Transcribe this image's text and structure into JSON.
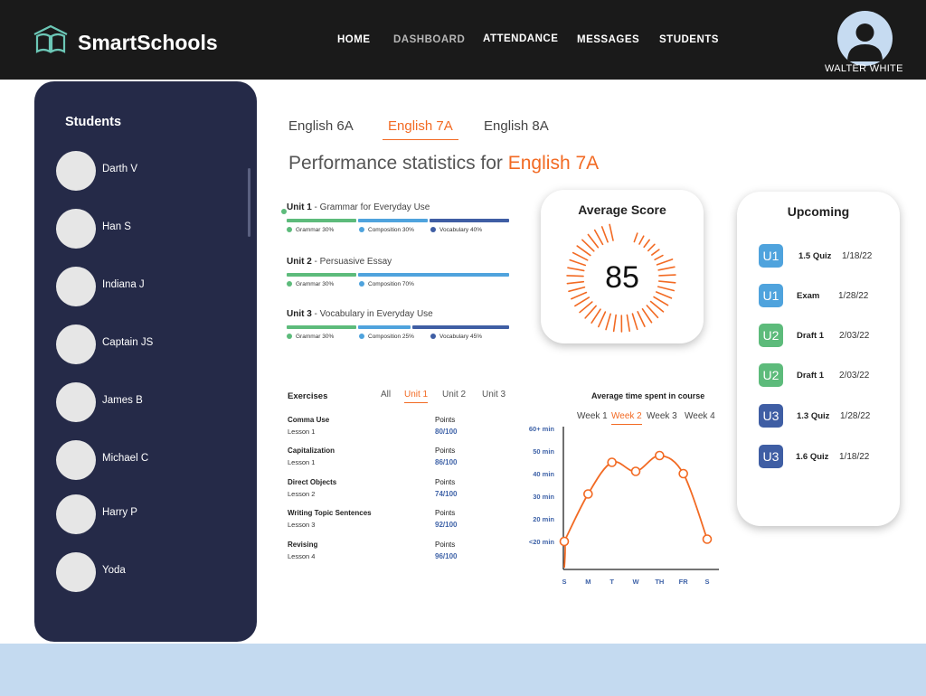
{
  "app": {
    "brand": "SmartSchools",
    "nav": [
      "HOME",
      "DASHBOARD",
      "ATTENDANCE",
      "MESSAGES",
      "STUDENTS"
    ],
    "user_name": "WALTER WHITE",
    "active_nav": "DASHBOARD"
  },
  "sidebar": {
    "title": "Students",
    "students": [
      "Darth V",
      "Han S",
      "Indiana J",
      "Captain JS",
      "James B",
      "Michael C",
      "Harry P",
      "Yoda"
    ]
  },
  "class_tabs": {
    "items": [
      "English 6A",
      "English 7A",
      "English 8A"
    ],
    "active": "English 7A"
  },
  "heading": {
    "prefix": "Performance statistics for",
    "class_name": "English 7A"
  },
  "units": [
    {
      "number": "Unit 1",
      "name": " - Grammar for Everyday Use",
      "segments": [
        {
          "label": "Grammar 30%",
          "color": "#5dbb7b"
        },
        {
          "label": "Composition 30%",
          "color": "#4fa3dd"
        },
        {
          "label": "Vocabulary 40%",
          "color": "#3f5ea4"
        }
      ]
    },
    {
      "number": "Unit 2",
      "name": " - Persuasive Essay",
      "segments": [
        {
          "label": "Grammar 30%",
          "color": "#5dbb7b"
        },
        {
          "label": "Composition 70%",
          "color": "#4fa3dd"
        }
      ]
    },
    {
      "number": "Unit 3",
      "name": " - Vocabulary in Everyday Use",
      "segments": [
        {
          "label": "Grammar 30%",
          "color": "#5dbb7b"
        },
        {
          "label": "Composition 25%",
          "color": "#4fa3dd"
        },
        {
          "label": "Vocabulary 45%",
          "color": "#3f5ea4"
        }
      ]
    }
  ],
  "average_score": {
    "title": "Average Score",
    "value": "85"
  },
  "upcoming": {
    "title": "Upcoming",
    "items": [
      {
        "unit": "U1",
        "type": "1.5 Quiz",
        "date": "1/18/22",
        "color": "#4fa3dd"
      },
      {
        "unit": "U1",
        "type": "Exam",
        "date": "1/28/22",
        "color": "#4fa3dd"
      },
      {
        "unit": "U2",
        "type": "Draft 1",
        "date": "2/03/22",
        "color": "#5dbb7b"
      },
      {
        "unit": "U2",
        "type": "Draft 1",
        "date": "2/03/22",
        "color": "#5dbb7b"
      },
      {
        "unit": "U3",
        "type": "1.3 Quiz",
        "date": "1/28/22",
        "color": "#3f5ea4"
      },
      {
        "unit": "U3",
        "type": "1.6 Quiz",
        "date": "1/18/22",
        "color": "#3f5ea4"
      }
    ]
  },
  "exercises": {
    "title": "Exercises",
    "tabs": [
      "All",
      "Unit 1",
      "Unit 2",
      "Unit 3"
    ],
    "active_tab": "Unit 1",
    "points_label": "Points",
    "items": [
      {
        "name": "Comma Use",
        "lesson": "Lesson 1",
        "score": "80/100"
      },
      {
        "name": "Capitalization",
        "lesson": "Lesson 1",
        "score": "86/100"
      },
      {
        "name": "Direct Objects",
        "lesson": "Lesson 2",
        "score": "74/100"
      },
      {
        "name": "Writing Topic Sentences",
        "lesson": "Lesson 3",
        "score": "92/100"
      },
      {
        "name": "Revising",
        "lesson": "Lesson 4",
        "score": "96/100"
      }
    ]
  },
  "time_chart": {
    "title": "Average time spent in course",
    "weeks": [
      "Week 1",
      "Week 2",
      "Week 3",
      "Week 4"
    ],
    "active_week": "Week 2"
  },
  "chart_data": {
    "type": "line",
    "title": "Average time spent in course",
    "categories": [
      "S",
      "M",
      "T",
      "W",
      "TH",
      "FR",
      "S"
    ],
    "y_tick_labels": [
      "<20 min",
      "20 min",
      "30 min",
      "40 min",
      "50 min",
      "60+ min"
    ],
    "y_tick_values": [
      10,
      20,
      30,
      40,
      50,
      60
    ],
    "ylim": [
      0,
      60
    ],
    "series": [
      {
        "values": [
          10,
          31,
          45,
          41,
          48,
          40,
          11
        ],
        "color": "#f26a23"
      }
    ],
    "grid": false
  }
}
